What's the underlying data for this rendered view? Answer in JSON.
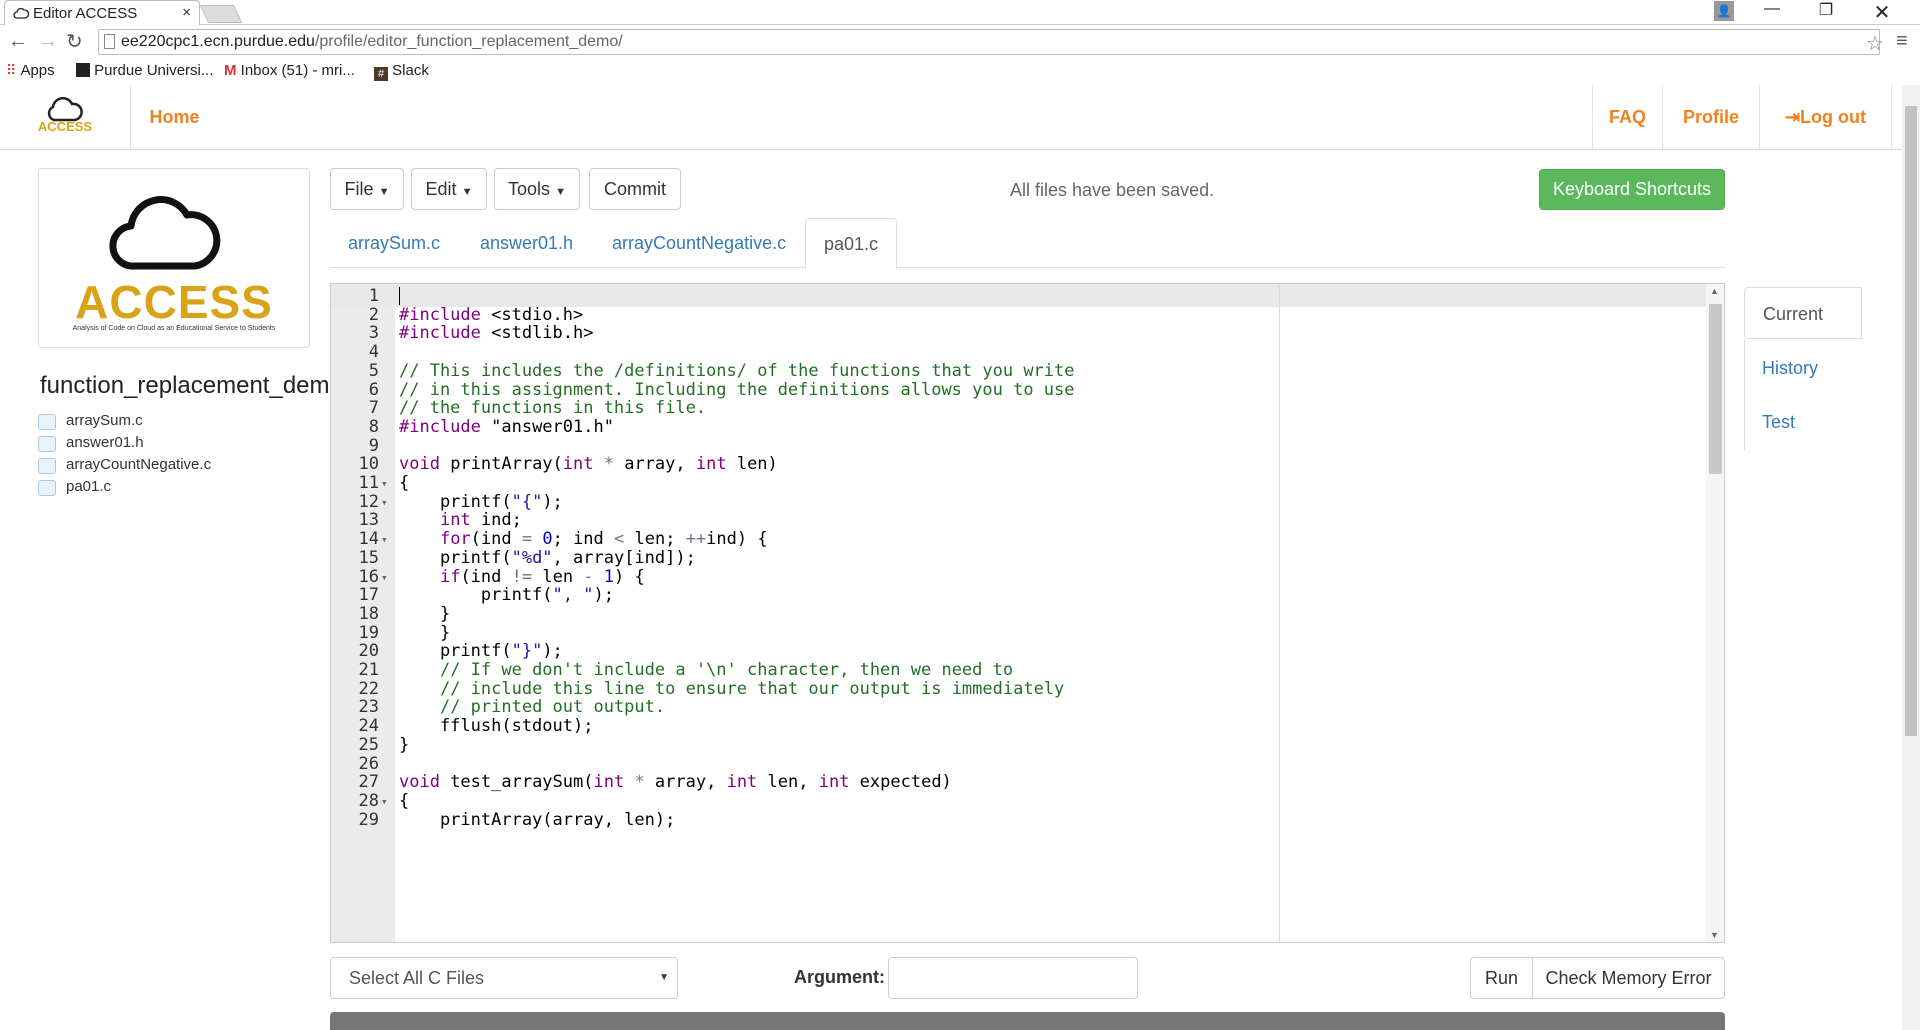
{
  "browser": {
    "tab_title": "Editor ACCESS",
    "tab_close": "×",
    "url_host": "ee220cpc1.ecn.purdue.edu",
    "url_path": "/profile/editor_function_replacement_demo/",
    "bookmarks": [
      "Apps",
      "Purdue Universi...",
      "Inbox (51) - mri...",
      "Slack"
    ]
  },
  "nav": {
    "home": "Home",
    "faq": "FAQ",
    "profile": "Profile",
    "logout": "Log out",
    "logo_small": "ACCESS"
  },
  "logo": {
    "word": "ACCESS",
    "tagline": "Analysis of Code on Cloud as an Educational Service to Students"
  },
  "project": {
    "title": "function_replacement_demo",
    "files": [
      "arraySum.c",
      "answer01.h",
      "arrayCountNegative.c",
      "pa01.c"
    ]
  },
  "toolbar": {
    "file": "File",
    "edit": "Edit",
    "tools": "Tools",
    "commit": "Commit",
    "status": "All files have been saved.",
    "shortcuts": "Keyboard Shortcuts"
  },
  "tabs": [
    "arraySum.c",
    "answer01.h",
    "arrayCountNegative.c",
    "pa01.c"
  ],
  "active_tab": "pa01.c",
  "side_tabs": [
    "Current",
    "History",
    "Test"
  ],
  "editor": {
    "lines": [
      "",
      "#include <stdio.h>",
      "#include <stdlib.h>",
      "",
      "// This includes the /definitions/ of the functions that you write",
      "// in this assignment. Including the definitions allows you to use",
      "// the functions in this file.",
      "#include \"answer01.h\"",
      "",
      "void printArray(int * array, int len)",
      "{",
      "    printf(\"{\");",
      "    int ind;",
      "    for(ind = 0; ind < len; ++ind) {",
      "    printf(\"%d\", array[ind]);",
      "    if(ind != len - 1) {",
      "        printf(\", \");",
      "    }",
      "    }",
      "    printf(\"}\");",
      "    // If we don't include a '\\n' character, then we need to",
      "    // include this line to ensure that our output is immediately",
      "    // printed out output.",
      "    fflush(stdout);",
      "}",
      "",
      "void test_arraySum(int * array, int len, int expected)",
      "{",
      "    printArray(array, len);"
    ],
    "fold_lines": [
      11,
      12,
      14,
      16,
      28
    ]
  },
  "bottom": {
    "select": "Select All C Files",
    "argument_label": "Argument:",
    "run": "Run",
    "memcheck": "Check Memory Error"
  },
  "colors": {
    "accent": "#f0821e",
    "green": "#5cb85c",
    "link": "#337ab7"
  }
}
